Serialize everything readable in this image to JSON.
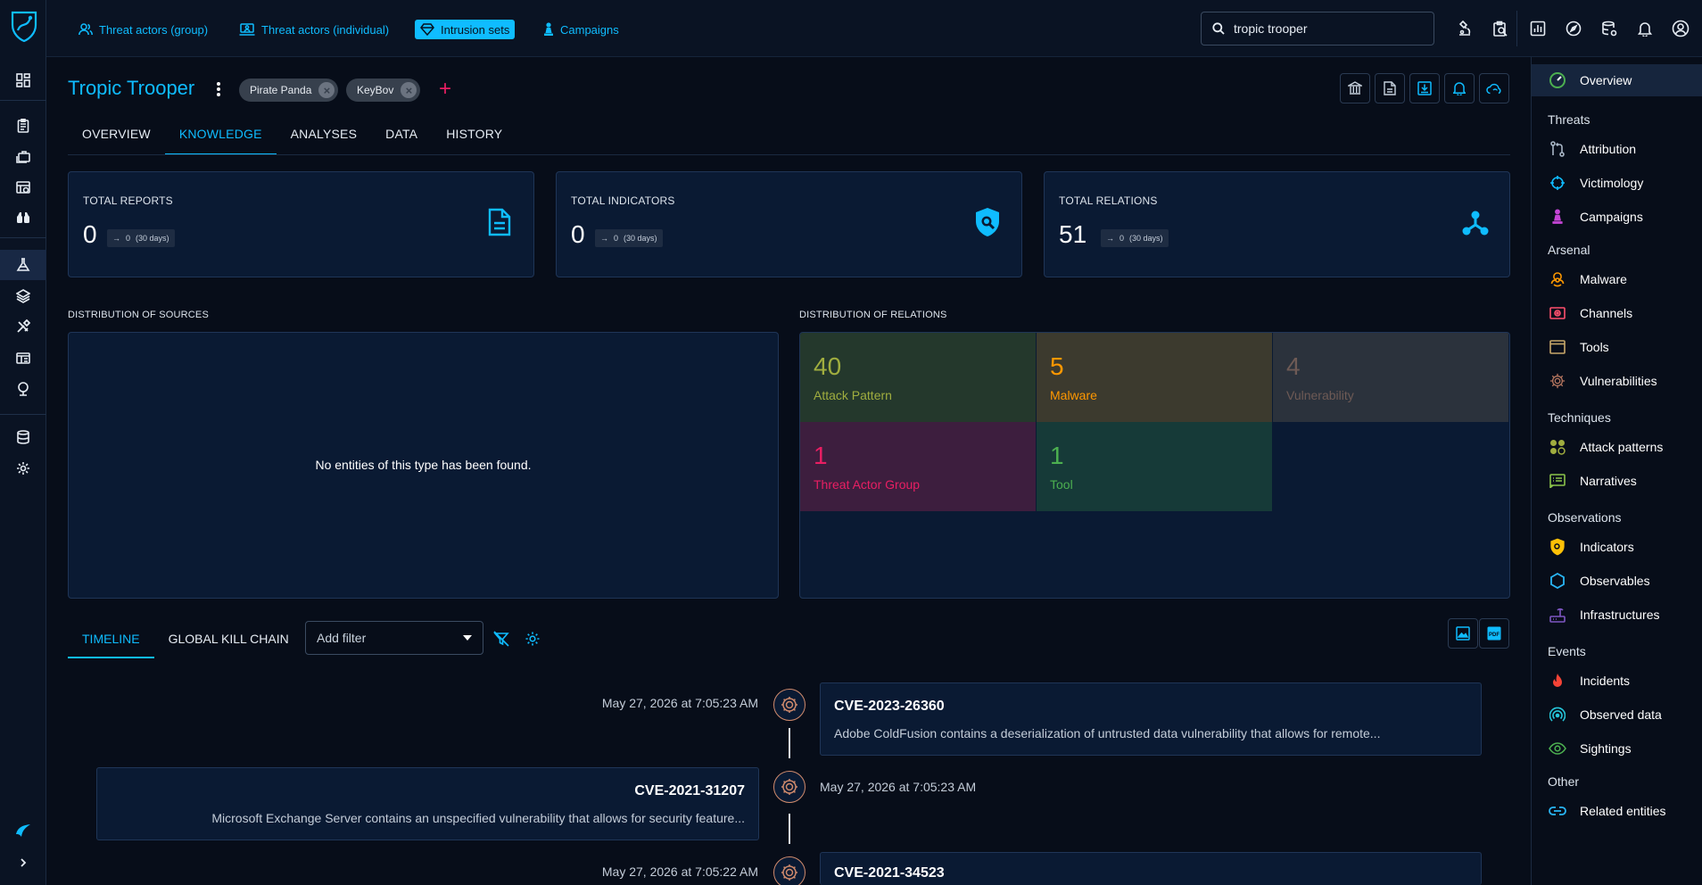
{
  "topbar": {
    "nav": [
      {
        "label": "Threat actors (group)",
        "icon": "users-icon",
        "active": false
      },
      {
        "label": "Threat actors (individual)",
        "icon": "user-laptop-icon",
        "active": false
      },
      {
        "label": "Intrusion sets",
        "icon": "diamond-icon",
        "active": true
      },
      {
        "label": "Campaigns",
        "icon": "chess-pawn-icon",
        "active": false
      }
    ],
    "search_value": "tropic trooper"
  },
  "entity": {
    "title": "Tropic Trooper",
    "aliases": [
      "Pirate Panda",
      "KeyBov"
    ]
  },
  "tabs": [
    "OVERVIEW",
    "KNOWLEDGE",
    "ANALYSES",
    "DATA",
    "HISTORY"
  ],
  "active_tab": "KNOWLEDGE",
  "stats": [
    {
      "label": "TOTAL REPORTS",
      "value": "0",
      "trend_value": "0",
      "trend_period": "(30 days)",
      "icon": "report-icon"
    },
    {
      "label": "TOTAL INDICATORS",
      "value": "0",
      "trend_value": "0",
      "trend_period": "(30 days)",
      "icon": "indicator-shield-icon"
    },
    {
      "label": "TOTAL RELATIONS",
      "value": "51",
      "trend_value": "0",
      "trend_period": "(30 days)",
      "icon": "relations-icon"
    }
  ],
  "sources": {
    "title": "DISTRIBUTION OF SOURCES",
    "empty_text": "No entities of this type has been found."
  },
  "relations": {
    "title": "DISTRIBUTION OF RELATIONS",
    "tiles": [
      {
        "count": "40",
        "label": "Attack Pattern",
        "bg": "#24382c",
        "fg": "#a0ad3f"
      },
      {
        "count": "5",
        "label": "Malware",
        "bg": "#3c3a2e",
        "fg": "#ff9800"
      },
      {
        "count": "4",
        "label": "Vulnerability",
        "bg": "#2b323c",
        "fg": "#6e5a55"
      },
      {
        "count": "1",
        "label": "Threat Actor Group",
        "bg": "#3d1e3e",
        "fg": "#e91e63"
      },
      {
        "count": "1",
        "label": "Tool",
        "bg": "#163a38",
        "fg": "#4caf50"
      }
    ]
  },
  "lower": {
    "tabs": [
      "TIMELINE",
      "GLOBAL KILL CHAIN"
    ],
    "active_tab": "TIMELINE",
    "filter_placeholder": "Add filter"
  },
  "timeline": [
    {
      "date": "May 27, 2026 at 7:05:23 AM",
      "title": "CVE-2023-26360",
      "desc": "Adobe ColdFusion contains a deserialization of untrusted data vulnerability that allows for remote...",
      "side": "right"
    },
    {
      "date": "May 27, 2026 at 7:05:23 AM",
      "title": "CVE-2021-31207",
      "desc": "Microsoft Exchange Server contains an unspecified vulnerability that allows for security feature...",
      "side": "left"
    },
    {
      "date": "May 27, 2026 at 7:05:22 AM",
      "title": "CVE-2021-34523",
      "desc": "",
      "side": "right"
    }
  ],
  "rightnav": {
    "overview": "Overview",
    "groups": [
      {
        "label": "Threats",
        "items": [
          {
            "label": "Attribution",
            "color": "#a8b6c6",
            "icon": "attribution-icon"
          },
          {
            "label": "Victimology",
            "color": "#0fbcff",
            "icon": "crosshair-icon"
          },
          {
            "label": "Campaigns",
            "color": "#c545d6",
            "icon": "chess-pawn-icon"
          }
        ]
      },
      {
        "label": "Arsenal",
        "items": [
          {
            "label": "Malware",
            "color": "#ff9800",
            "icon": "biohazard-icon"
          },
          {
            "label": "Channels",
            "color": "#ff4f6d",
            "icon": "channel-icon"
          },
          {
            "label": "Tools",
            "color": "#c9a86a",
            "icon": "window-icon"
          },
          {
            "label": "Vulnerabilities",
            "color": "#b3745e",
            "icon": "bug-icon"
          }
        ]
      },
      {
        "label": "Techniques",
        "items": [
          {
            "label": "Attack patterns",
            "color": "#a0ad3f",
            "icon": "attack-pattern-icon"
          },
          {
            "label": "Narratives",
            "color": "#8bc34a",
            "icon": "narrative-icon"
          }
        ]
      },
      {
        "label": "Observations",
        "items": [
          {
            "label": "Indicators",
            "color": "#ffc107",
            "icon": "indicator-shield-icon"
          },
          {
            "label": "Observables",
            "color": "#29b6f6",
            "icon": "hexagon-icon"
          },
          {
            "label": "Infrastructures",
            "color": "#7e57c2",
            "icon": "router-icon"
          }
        ]
      },
      {
        "label": "Events",
        "items": [
          {
            "label": "Incidents",
            "color": "#f44336",
            "icon": "fire-icon"
          },
          {
            "label": "Observed data",
            "color": "#26c6da",
            "icon": "radar-icon"
          },
          {
            "label": "Sightings",
            "color": "#4caf50",
            "icon": "eye-icon"
          }
        ]
      },
      {
        "label": "Other",
        "items": [
          {
            "label": "Related entities",
            "color": "#29b6f6",
            "icon": "link-icon"
          }
        ]
      }
    ]
  }
}
